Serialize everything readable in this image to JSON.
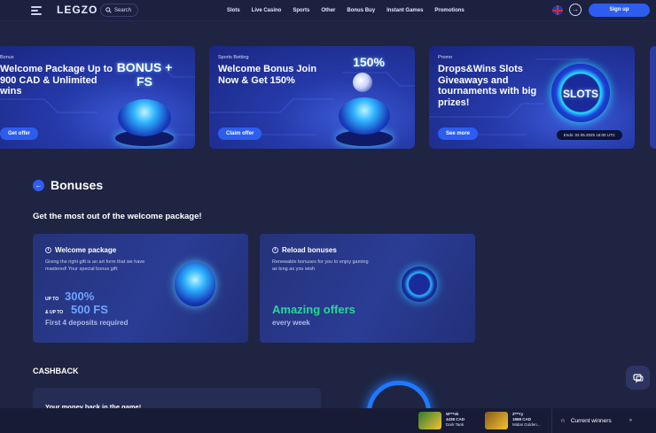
{
  "header": {
    "logo": "LEGZO",
    "search_label": "Search",
    "nav": [
      "Slots",
      "Live Casino",
      "Sports",
      "Other",
      "Bonus Buy",
      "Instant Games",
      "Promotions"
    ],
    "signup_label": "Sign up"
  },
  "banners": [
    {
      "tag": "Bonus",
      "title": "Welcome Package Up to 900 CAD & Unlimited wins",
      "art": "BONUS + FS",
      "button": "Get offer"
    },
    {
      "tag": "Sports Betting",
      "title": "Welcome Bonus Join Now & Get 150%",
      "art": "150%",
      "button": "Claim offer"
    },
    {
      "tag": "Promo",
      "title": "Drops&Wins Slots Giveaways and tournaments with big prizes!",
      "art": "SLOTS",
      "button": "See more",
      "ends": "Ends: 02.05.2025 16:00 UTC"
    }
  ],
  "bonuses": {
    "title": "Bonuses",
    "subtitle": "Get the most out of the welcome package!",
    "cards": [
      {
        "title": "Welcome package",
        "text": "Giving the right gift is an art form that we have mastered! Your special bonus gift:",
        "up_to_1": "UP TO",
        "value_1": "300%",
        "up_to_2": "& UP TO",
        "value_2": "500 FS",
        "footer": "First 4 deposits required"
      },
      {
        "title": "Reload bonuses",
        "text": "Renewable bonuses for you to enjoy gaming as long as you wish",
        "headline": "Amazing offers",
        "footer": "every week"
      }
    ]
  },
  "cashback": {
    "title": "CASHBACK",
    "text": "Your money back in the game!"
  },
  "winners": {
    "items": [
      {
        "user": "W***ek",
        "amount": "4438 CAD",
        "game": "Dark Tank"
      },
      {
        "user": "Z***ry",
        "amount": "1868 CAD",
        "game": "Midas Golden..."
      }
    ],
    "label": "Current winners"
  },
  "colors": {
    "accent": "#2d5df0",
    "green": "#27d69a",
    "bg": "#1f2442"
  }
}
